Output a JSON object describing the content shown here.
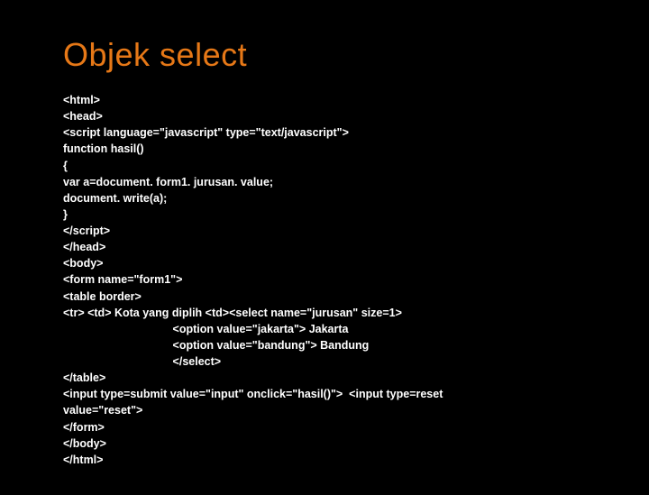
{
  "title": "Objek select",
  "code_lines": [
    "<html>",
    "<head>",
    "<script language=\"javascript\" type=\"text/javascript\">",
    "function hasil()",
    "{",
    "var a=document. form1. jurusan. value;",
    "document. write(a);",
    "}",
    "</script>",
    "</head>",
    "<body>",
    "<form name=\"form1\">",
    "<table border>",
    "<tr> <td> Kota yang diplih <td><select name=\"jurusan\" size=1>",
    "                                   <option value=\"jakarta\"> Jakarta",
    "                                   <option value=\"bandung\"> Bandung",
    "                                   </select>",
    "</table>",
    "<input type=submit value=\"input\" onclick=\"hasil()\">  <input type=reset",
    "value=\"reset\">",
    "</form>",
    "</body>",
    "</html>"
  ]
}
